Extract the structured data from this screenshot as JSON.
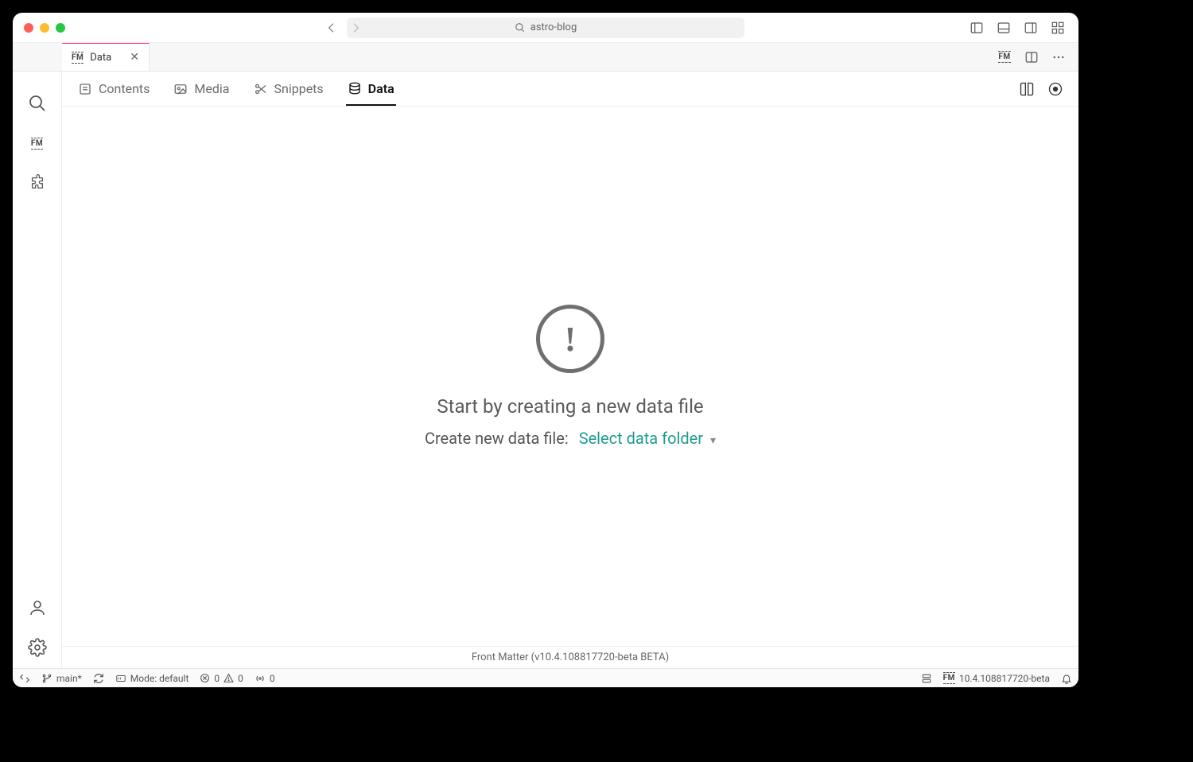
{
  "titlebar": {
    "search_text": "astro-blog"
  },
  "tab": {
    "title": "Data",
    "badge": "FM"
  },
  "subnav": {
    "items": [
      {
        "label": "Contents"
      },
      {
        "label": "Media"
      },
      {
        "label": "Snippets"
      },
      {
        "label": "Data"
      }
    ]
  },
  "empty": {
    "title": "Start by creating a new data file",
    "sub_prefix": "Create new data file:",
    "link": "Select data folder"
  },
  "footer": {
    "text": "Front Matter (v10.4.108817720-beta BETA)"
  },
  "status": {
    "branch": "main*",
    "mode_label": "Mode: default",
    "errors": "0",
    "warnings": "0",
    "ports": "0",
    "version": "10.4.108817720-beta",
    "fm_badge": "FM"
  }
}
